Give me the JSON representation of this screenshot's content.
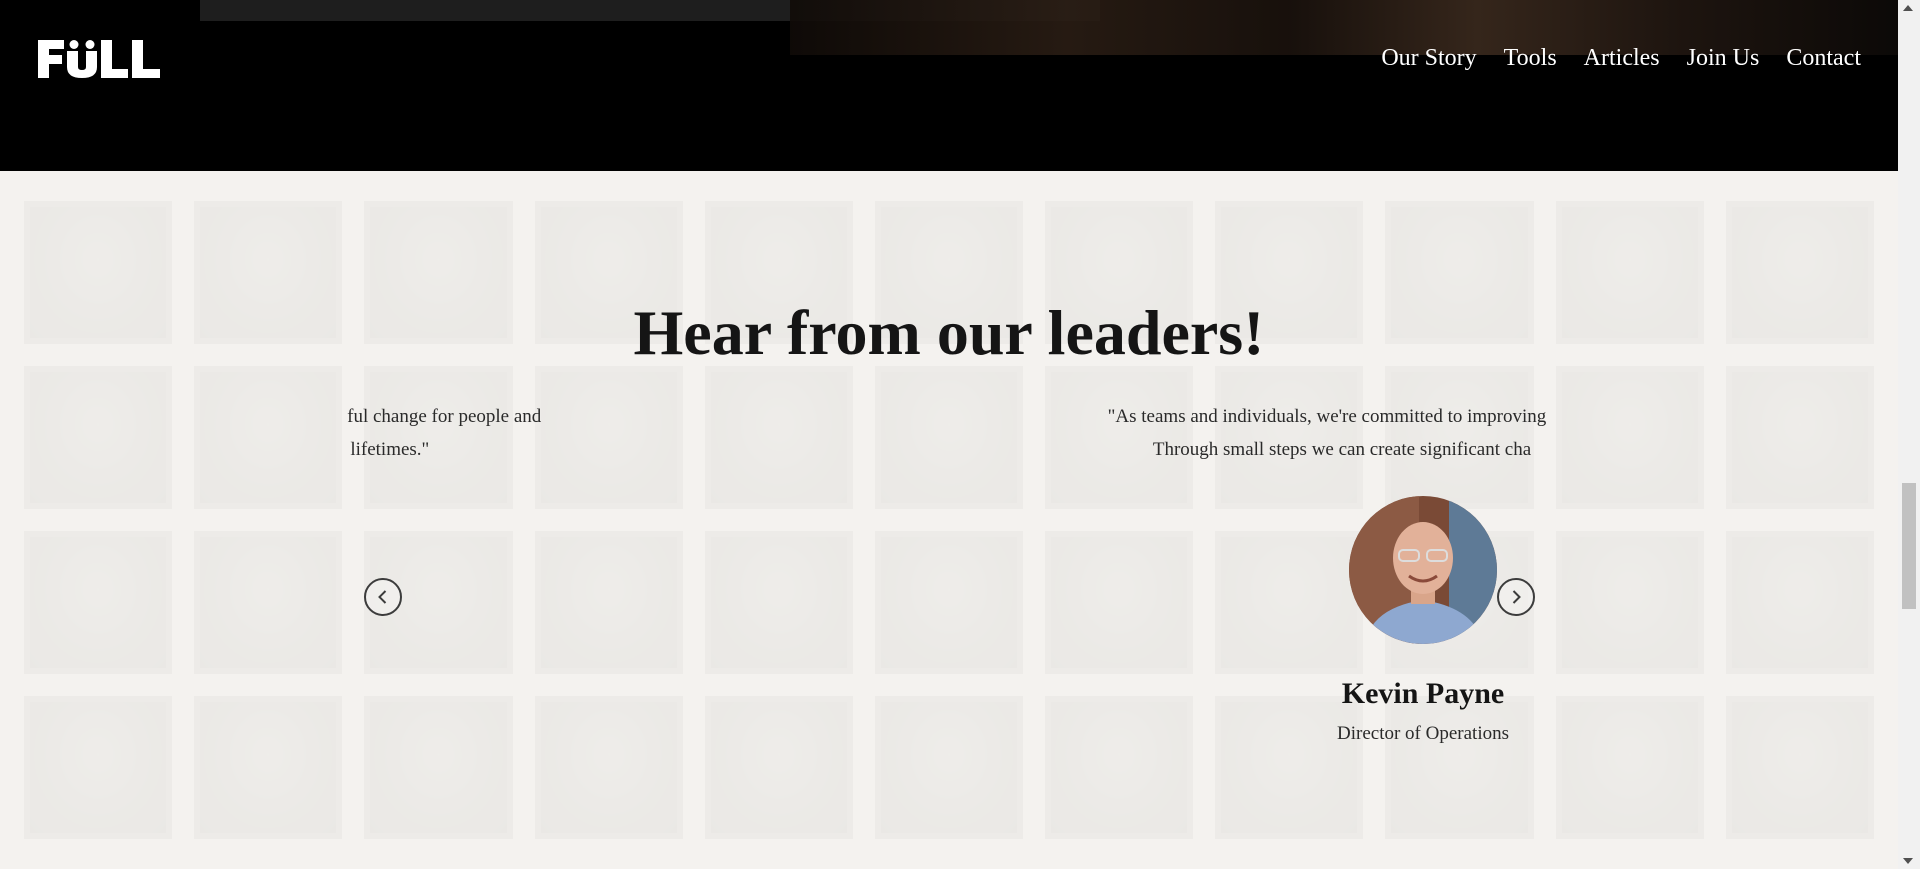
{
  "brand": {
    "logo_text": "FULL"
  },
  "nav": {
    "items": [
      "Our Story",
      "Tools",
      "Articles",
      "Join Us",
      "Contact"
    ]
  },
  "testimonials": {
    "heading": "Hear from our leaders!",
    "quotes": [
      {
        "line1": "neaningful change for people and",
        "line2": "ond our lifetimes.\""
      },
      {
        "line1": "\"As teams and individuals, we're committed to improving our",
        "line2": "Through small steps we can create significant cha"
      }
    ],
    "active_person": {
      "name": "Kevin Payne",
      "role": "Director of Operations"
    }
  },
  "icons": {
    "prev": "chevron-left-icon",
    "next": "chevron-right-icon"
  },
  "colors": {
    "header_bg": "#000000",
    "text_dark": "#151515",
    "section_bg": "#f3f2f0"
  }
}
